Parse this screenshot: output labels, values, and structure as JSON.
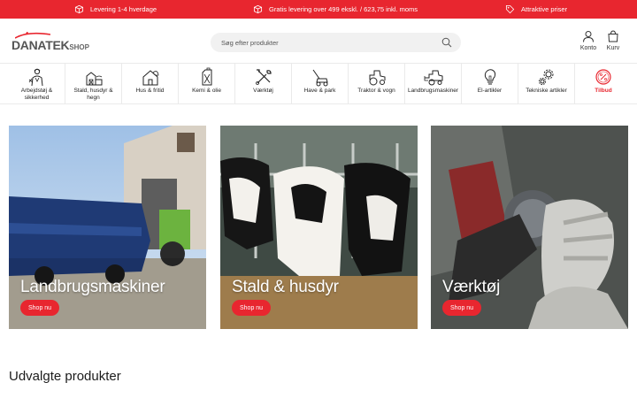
{
  "topbar": {
    "delivery": "Levering 1-4 hverdage",
    "shipping": "Gratis levering over 499 ekskl. / 623,75 inkl. moms",
    "prices": "Attraktive priser"
  },
  "header": {
    "logo": {
      "brand_main": "DANATEK",
      "brand_sub": "SHOP"
    },
    "search": {
      "placeholder": "Søg efter produkter",
      "value": ""
    },
    "account_label": "Konto",
    "cart_label": "Kurv"
  },
  "categories": [
    {
      "label": "Arbejdstøj & sikkerhed",
      "icon": "worker-icon"
    },
    {
      "label": "Stald, husdyr & hegn",
      "icon": "barn-icon"
    },
    {
      "label": "Hus & fritid",
      "icon": "house-icon"
    },
    {
      "label": "Kemi & olie",
      "icon": "canister-icon"
    },
    {
      "label": "Værktøj",
      "icon": "tools-icon"
    },
    {
      "label": "Have & park",
      "icon": "lawnmower-icon"
    },
    {
      "label": "Traktor & vogn",
      "icon": "tractor-icon"
    },
    {
      "label": "Landbrugsmaskiner",
      "icon": "harvester-icon"
    },
    {
      "label": "El-artikler",
      "icon": "lightbulb-icon"
    },
    {
      "label": "Tekniske artikler",
      "icon": "gears-icon"
    },
    {
      "label": "Tilbud",
      "icon": "percent-icon"
    }
  ],
  "tiles": [
    {
      "title": "Landbrugsmaskiner",
      "button": "Shop nu",
      "image": "farm-machine-photo"
    },
    {
      "title": "Stald & husdyr",
      "button": "Shop nu",
      "image": "cows-photo"
    },
    {
      "title": "Værktøj",
      "button": "Shop nu",
      "image": "angle-grinder-photo"
    }
  ],
  "sections": {
    "featured_title": "Udvalgte produkter"
  },
  "colors": {
    "accent": "#e8262f",
    "text": "#1c1c1c",
    "search_bg": "#f1f1f1"
  }
}
